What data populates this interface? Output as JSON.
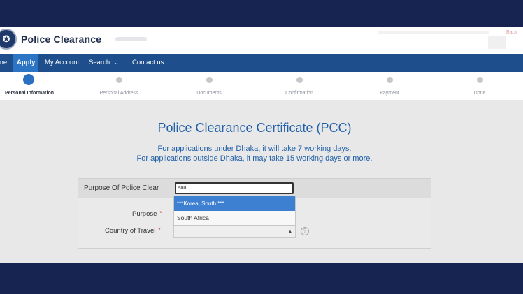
{
  "header": {
    "title": "Police Clearance",
    "back_label": "Back"
  },
  "nav": {
    "items": [
      {
        "label": "me"
      },
      {
        "label": "Apply"
      },
      {
        "label": "My Account"
      },
      {
        "label": "Search"
      },
      {
        "label": "Contact us"
      }
    ]
  },
  "steps": [
    {
      "label": "Personal Information"
    },
    {
      "label": "Personal Address"
    },
    {
      "label": "Documents"
    },
    {
      "label": "Confirmation"
    },
    {
      "label": "Payment"
    },
    {
      "label": "Done"
    }
  ],
  "main": {
    "title": "Police Clearance Certificate (PCC)",
    "info_dhaka": "For applications under Dhaka, it will take 7 working days.",
    "info_outside": "For applications outside Dhaka, it may take 15 working days or more."
  },
  "form": {
    "panel_title": "Purpose Of Police Clear",
    "search_value": "sou",
    "options": [
      "***Korea, South ***",
      "South Africa"
    ],
    "purpose_label": "Purpose",
    "country_label": "Country of Travel",
    "required_mark": "*",
    "help_symbol": "?"
  },
  "icons": {
    "logo": "police-emblem",
    "nav_dropdown": "chevron-down-icon",
    "select_caret": "caret-up-icon",
    "help": "question-icon"
  },
  "colors": {
    "nav_bg": "#1e4f8c",
    "nav_active": "#2c74c4",
    "title_blue": "#2160a8",
    "selected_option": "#3d7fd1",
    "outer_bg": "#172351"
  }
}
